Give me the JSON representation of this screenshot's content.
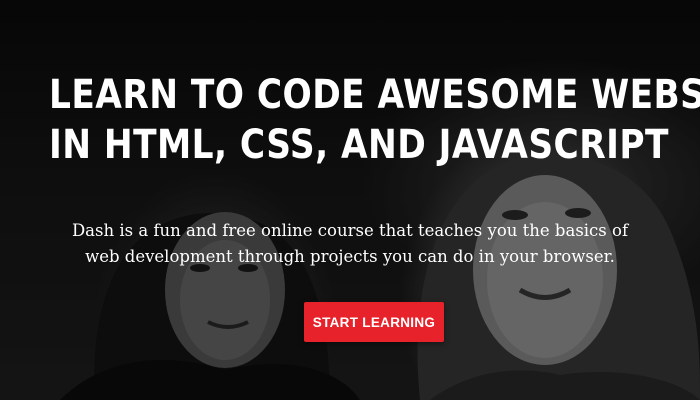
{
  "hero": {
    "headline_line1": "LEARN TO CODE AWESOME WEBSITES",
    "headline_line2": "IN HTML, CSS, AND JAVASCRIPT",
    "subtext": "Dash is a fun and free online course that teaches you the basics of web development through projects you can do in your browser.",
    "cta_label": "START LEARNING",
    "background_image": "two-women-looking-at-screen-photo"
  },
  "colors": {
    "cta_background": "#e8222a",
    "text": "#ffffff",
    "background": "#000000"
  }
}
